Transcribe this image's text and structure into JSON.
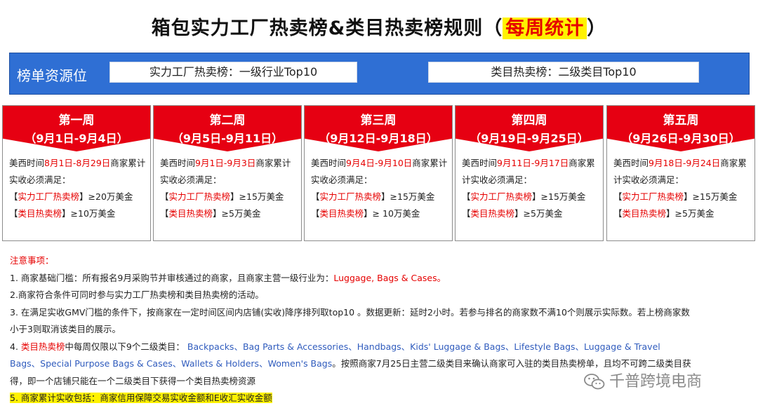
{
  "title": {
    "main": "箱包实力工厂热卖榜&类目热卖榜规则（",
    "highlight": "每周统计",
    "end": "）"
  },
  "banner": {
    "label": "榜单资源位",
    "box1": "实力工厂热卖榜：一级行业Top10",
    "box2": "类目热卖榜：二级类目Top10"
  },
  "weeks": [
    {
      "name": "第一周",
      "dates": "（9月1日-9月4日）",
      "pre": "美西时间",
      "period": "8月1日-8月29日",
      "post": "商家累计实收必须满足：",
      "l1": "实力工厂热卖榜",
      "v1": "≥20万美金",
      "l2": "类目热卖榜",
      "v2": "≥10万美金"
    },
    {
      "name": "第二周",
      "dates": "（9月5日-9月11日）",
      "pre": "美西时间",
      "period": "9月1日-9月3日",
      "post": "商家累计实收必须满足：",
      "l1": "实力工厂热卖榜",
      "v1": "≥15万美金",
      "l2": "类目热卖榜",
      "v2": "≥5万美金"
    },
    {
      "name": "第三周",
      "dates": "（9月12日-9月18日）",
      "pre": "美西时间",
      "period": "9月4日-9月10日",
      "post": "商家累计实收必须满足：",
      "l1": "实力工厂热卖榜",
      "v1": "≥15万美金",
      "l2": "类目热卖榜",
      "v2": "≥ 10万美金"
    },
    {
      "name": "第四周",
      "dates": "（9月19日-9月25日）",
      "pre": "美西时间",
      "period": "9月11日-9月17日",
      "post": "商家累计实收必须满足：",
      "l1": "实力工厂热卖榜",
      "v1": "≥15万美金",
      "l2": "类目热卖榜",
      "v2": "≥5万美金"
    },
    {
      "name": "第五周",
      "dates": "（9月26日-9月30日）",
      "pre": "美西时间",
      "period": "9月18日-9月24日",
      "post": "商家累计实收必须满足：",
      "l1": "实力工厂热卖榜",
      "v1": "≥15万美金",
      "l2": "类目热卖榜",
      "v2": "≥5万美金"
    }
  ],
  "notes": {
    "heading": "注意事项：",
    "n1a": "1. 商家基础门槛：所有报名9月采购节并审核通过的商家，且商家主营一级行业为：",
    "n1b": "Luggage, Bags & Cases。",
    "n2": "2.商家符合条件可同时参与实力工厂热卖榜和类目热卖榜的活动。",
    "n3a": "3. 在满足实收GMV门槛的条件下，按商家在一定时间区间内店铺(实收)降序排列取top10 。数据更新：延时2小时。若参与排名的商家数不满10个则展示实际数。若上榜商家数",
    "n3b": "小于3则取消该类目的展示。",
    "n4a": "4. ",
    "n4b": "类目热卖榜",
    "n4c": "中每周仅限以下9个二级类目：",
    "n4d": "Backpacks、Bag Parts & Accessories、Handbags、Kids' Luggage & Bags、Lifestyle Bags、Luggage & Travel",
    "n4e": "Bags、Special Purpose Bags & Cases、Wallets & Holders、Women's Bags",
    "n4f": "。按照商家7月25日主营二级类目来确认商家可入驻的类目热卖榜单，且均不可跨二级类目获",
    "n4g": "得，即一个店铺只能在一个二级类目下获得一个类目热卖榜资源",
    "n5": "5. 商家累计实收包括：商家信用保障交易实收金额和E收汇实收金额"
  },
  "watermark": {
    "text": "千普跨境电商",
    "icon": "wechat-icon"
  }
}
